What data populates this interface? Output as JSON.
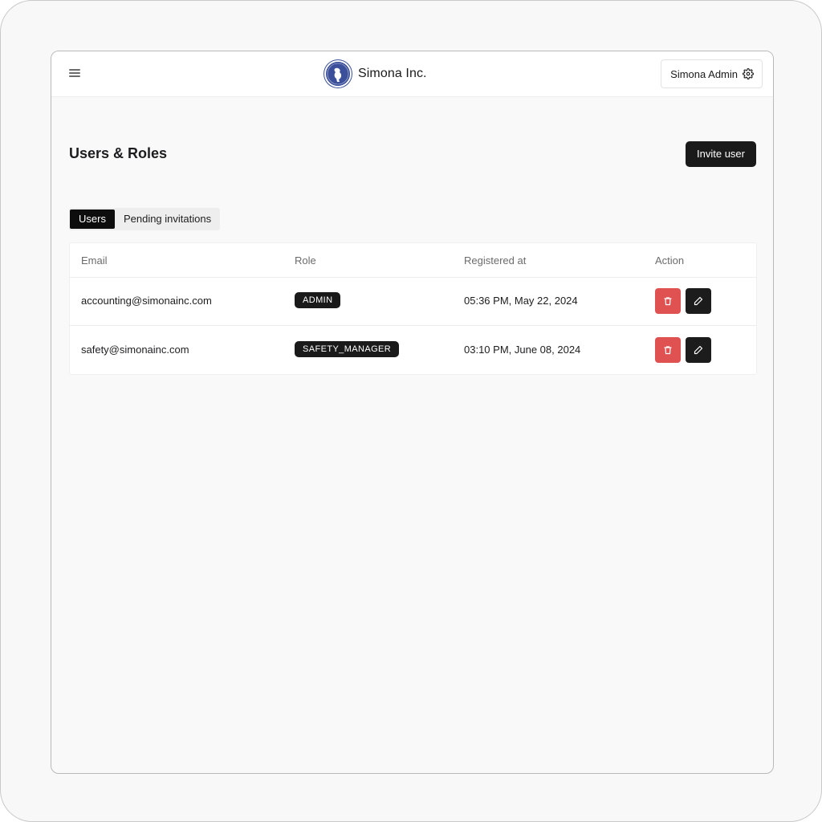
{
  "header": {
    "brand_name": "Simona Inc.",
    "user_menu_label": "Simona Admin"
  },
  "page": {
    "title": "Users & Roles",
    "invite_button_label": "Invite user"
  },
  "tabs": [
    {
      "label": "Users",
      "active": true
    },
    {
      "label": "Pending invitations",
      "active": false
    }
  ],
  "table": {
    "columns": [
      "Email",
      "Role",
      "Registered at",
      "Action"
    ],
    "rows": [
      {
        "email": "accounting@simonainc.com",
        "role": "ADMIN",
        "registered_at": "05:36 PM, May 22, 2024"
      },
      {
        "email": "safety@simonainc.com",
        "role": "SAFETY_MANAGER",
        "registered_at": "03:10 PM, June 08, 2024"
      }
    ]
  },
  "icons": {
    "menu": "hamburger-menu-icon",
    "settings": "gear-icon",
    "delete": "trash-icon",
    "edit": "pencil-icon"
  },
  "colors": {
    "primary": "#1a1a1a",
    "danger": "#e05252",
    "logo": "#3b4f9a"
  }
}
